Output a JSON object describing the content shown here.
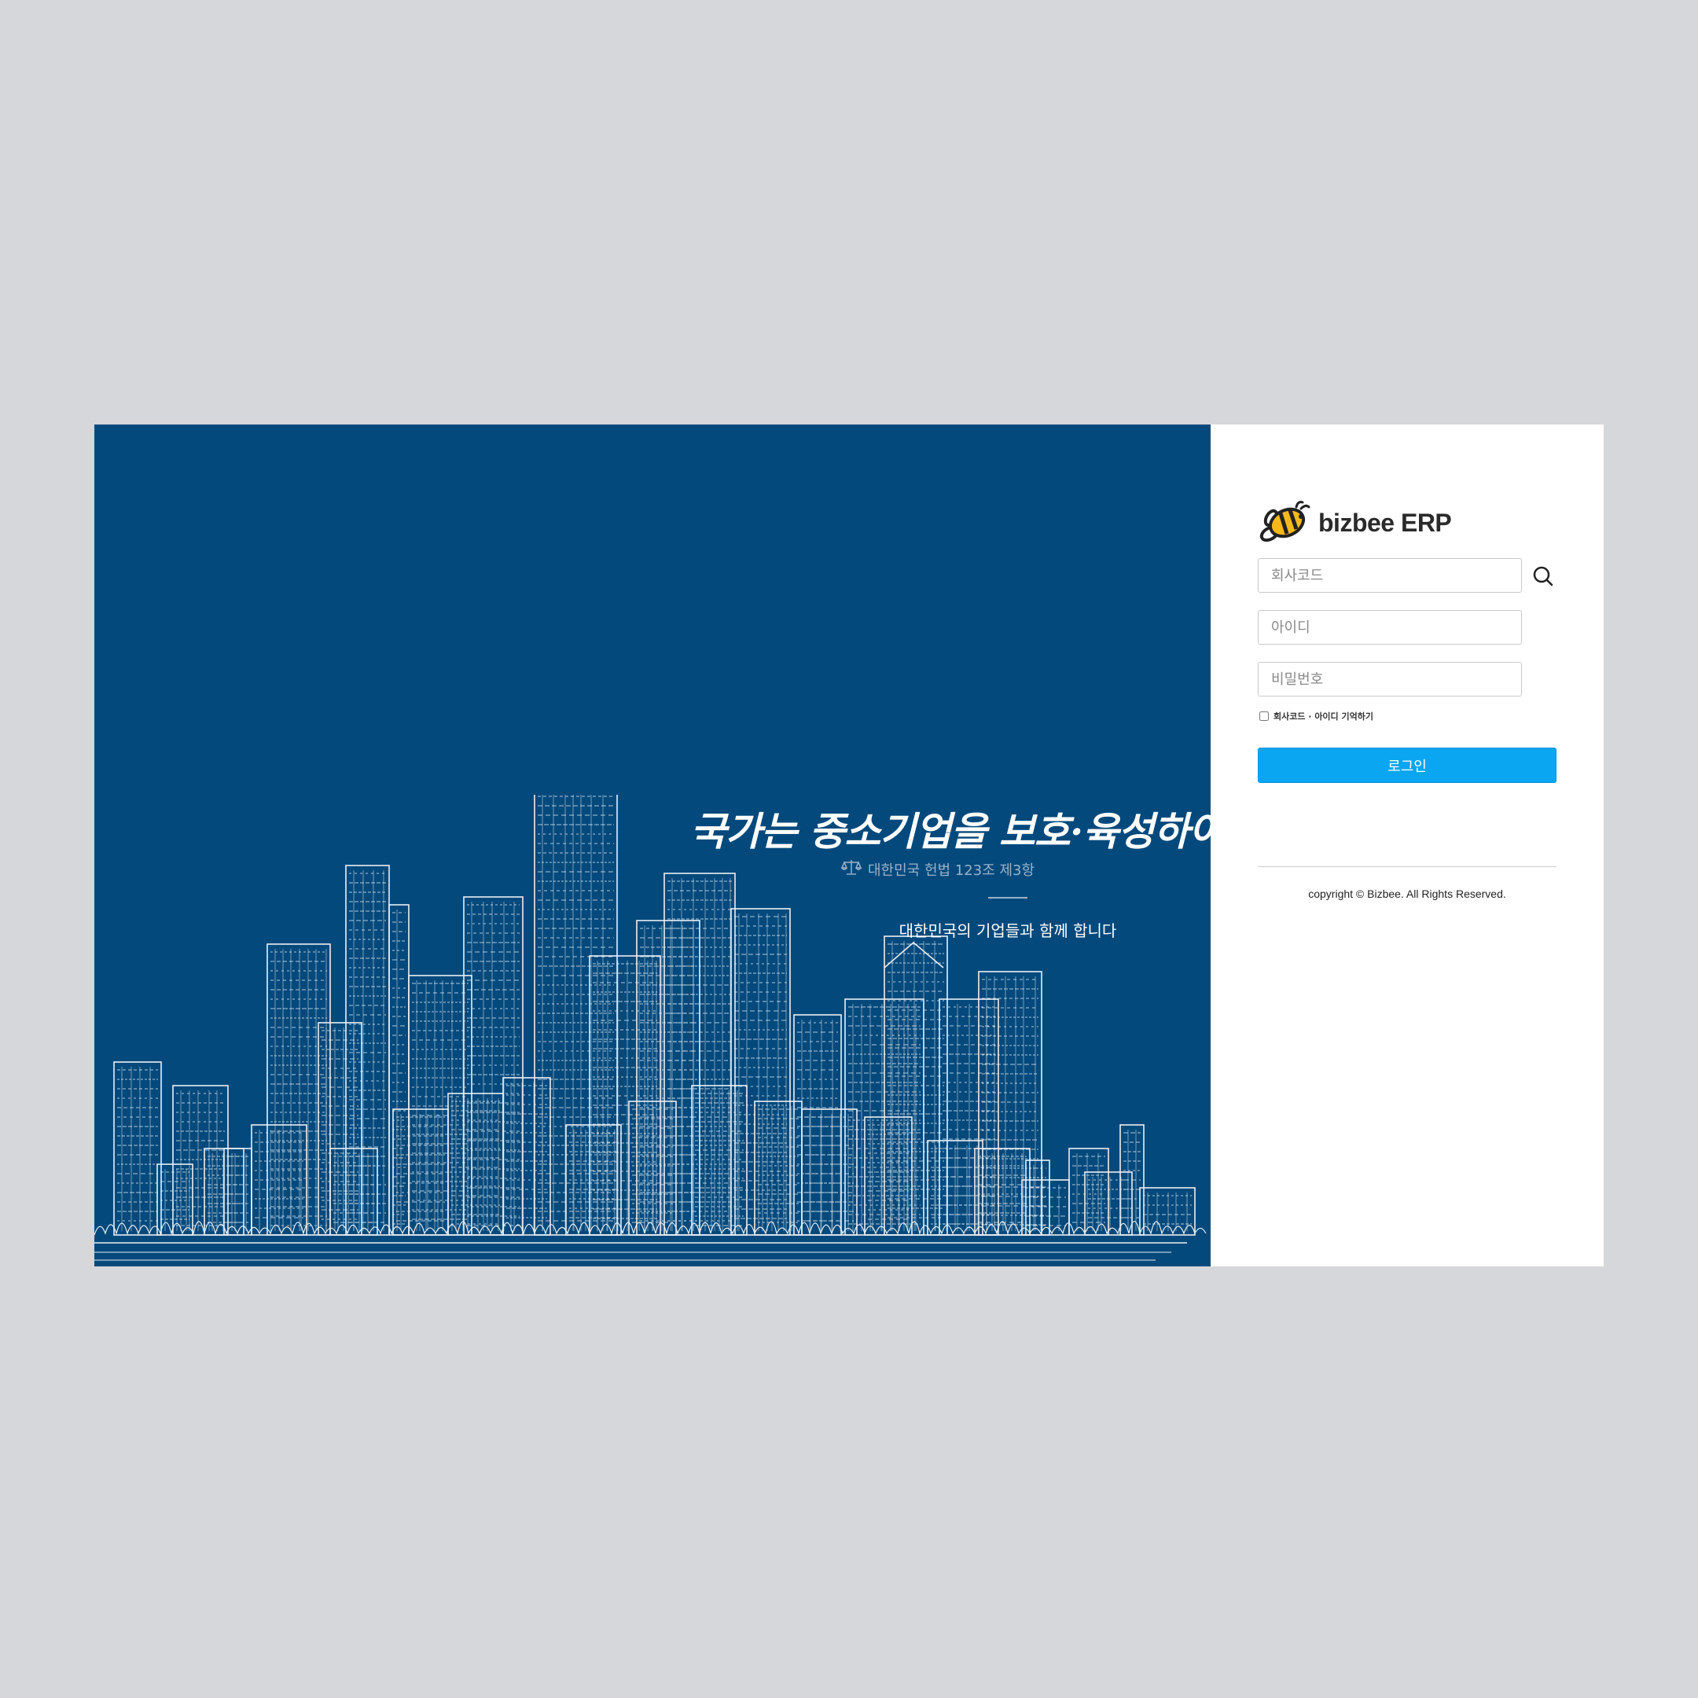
{
  "hero": {
    "slogan": "국가는 중소기업을 보호·육성하여야 한다",
    "citation": "대한민국 헌법 123조 제3항",
    "tagline": "대한민국의 기업들과 함께 합니다",
    "background_color": "#03497c",
    "illustration_icon": "city-skyline-sketch"
  },
  "logo": {
    "text": "bizbee ERP",
    "icon": "bee-icon"
  },
  "form": {
    "company_code_placeholder": "회사코드",
    "user_id_placeholder": "아이디",
    "password_placeholder": "비밀번호",
    "search_icon": "search-icon",
    "remember_label": "회사코드 · 아이디 기억하기",
    "remember_checked": false,
    "login_label": "로그인",
    "accent_color": "#0aa6f2"
  },
  "footer": {
    "copyright": "copyright © Bizbee. All Rights Reserved."
  }
}
